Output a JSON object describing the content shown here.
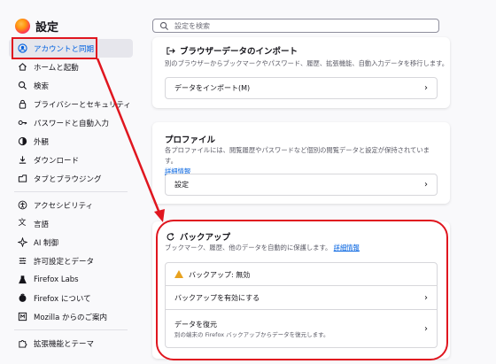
{
  "sidebar": {
    "title": "設定",
    "items_group1": [
      {
        "label": "アカウントと同期",
        "icon": "account-icon",
        "selected": true
      },
      {
        "label": "ホームと起動",
        "icon": "home-icon"
      },
      {
        "label": "検索",
        "icon": "search-icon"
      },
      {
        "label": "プライバシーとセキュリティ",
        "icon": "lock-icon"
      },
      {
        "label": "パスワードと自動入力",
        "icon": "key-icon"
      },
      {
        "label": "外観",
        "icon": "appearance-icon"
      },
      {
        "label": "ダウンロード",
        "icon": "download-icon"
      },
      {
        "label": "タブとブラウジング",
        "icon": "tabs-icon"
      }
    ],
    "items_group2": [
      {
        "label": "アクセシビリティ",
        "icon": "accessibility-icon"
      },
      {
        "label": "言語",
        "icon": "language-icon"
      },
      {
        "label": "AI 制御",
        "icon": "ai-icon"
      },
      {
        "label": "許可設定とデータ",
        "icon": "permissions-icon"
      },
      {
        "label": "Firefox Labs",
        "icon": "flask-icon"
      },
      {
        "label": "Firefox について",
        "icon": "firefox-icon"
      },
      {
        "label": "Mozilla からのご案内",
        "icon": "mozilla-icon"
      }
    ],
    "items_group3": [
      {
        "label": "拡張機能とテーマ",
        "icon": "extensions-icon"
      }
    ]
  },
  "search": {
    "placeholder": "設定を検索"
  },
  "import_card": {
    "title": "ブラウザーデータのインポート",
    "desc": "別のブラウザーからブックマークやパスワード、履歴、拡張機能、自動入力データを移行します。",
    "button": "データをインポート(M)"
  },
  "profiles_card": {
    "title": "プロファイル",
    "desc": "各プロファイルには、閲覧履歴やパスワードなど個別の閲覧データと設定が保持されています。",
    "link": "詳細情報",
    "button": "設定"
  },
  "backup_card": {
    "title": "バックアップ",
    "desc": "ブックマーク、履歴、他のデータを自動的に保護します。",
    "link": "詳細情報",
    "status": "バックアップ: 無効",
    "enable": "バックアップを有効にする",
    "restore_title": "データを復元",
    "restore_sub": "別の端末の Firefox バックアップからデータを復元します。"
  },
  "colors": {
    "accent": "#0061e0",
    "annotation": "#e0161f",
    "warning": "#e8a21f"
  }
}
